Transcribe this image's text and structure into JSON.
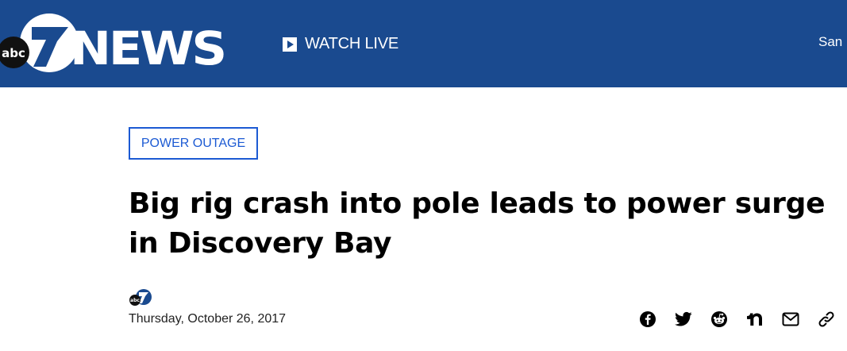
{
  "header": {
    "logo": {
      "network": "abc",
      "channel": "7",
      "brand": "NEWS"
    },
    "watch_live_label": "WATCH LIVE",
    "location_label": "San",
    "background_color": "#1a4a8f"
  },
  "article": {
    "category": "POWER OUTAGE",
    "headline": "Big rig crash into pole leads to power surge in Discovery Bay",
    "date": "Thursday, October 26, 2017",
    "accent_color": "#1c5ad3"
  },
  "share": {
    "icons": [
      "facebook-icon",
      "twitter-icon",
      "reddit-icon",
      "nextdoor-icon",
      "email-icon",
      "link-icon"
    ]
  }
}
